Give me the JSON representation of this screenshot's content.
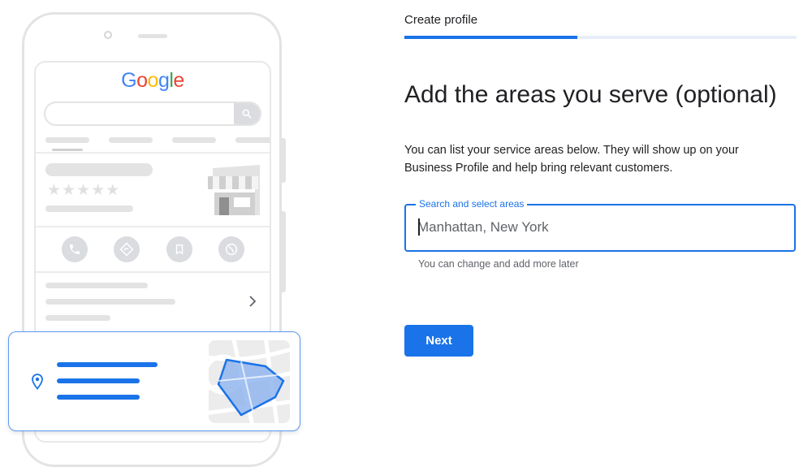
{
  "illustration": {
    "logo_letters": [
      "G",
      "o",
      "o",
      "g",
      "l",
      "e"
    ],
    "rating_stars": "★★★★★"
  },
  "form": {
    "step_title": "Create profile",
    "progress": 0.44,
    "heading": "Add the areas you serve (optional)",
    "description": "You can list your service areas below. They will show up on your Business Profile and help bring relevant customers.",
    "field_label": "Search and select areas",
    "field_placeholder": "Manhattan, New York",
    "helper_text": "You can change and add more later",
    "next_label": "Next"
  },
  "colors": {
    "accent": "#1a73e8",
    "ghost": "#e3e3e3"
  }
}
